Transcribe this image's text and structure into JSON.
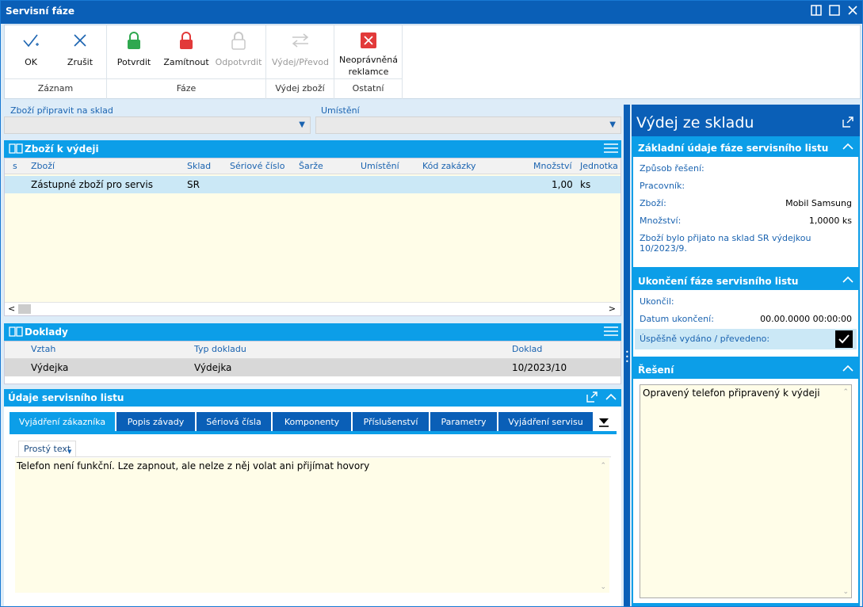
{
  "window": {
    "title": "Servisní fáze"
  },
  "ribbon": {
    "ok": "OK",
    "cancel": "Zrušit",
    "group_record": "Záznam",
    "confirm": "Potvrdit",
    "reject": "Zamítnout",
    "unconfirm": "Odpotvrdit",
    "group_phase": "Fáze",
    "issue": "Výdej/Převod",
    "group_issue": "Výdej zboží",
    "unjust_1": "Neoprávněná",
    "unjust_2": "reklamce",
    "group_other": "Ostatní"
  },
  "fields": {
    "prepare_label": "Zboží připravit na sklad",
    "location_label": "Umístění"
  },
  "goods_panel": {
    "title": "Zboží k výdeji",
    "columns": [
      "s",
      "Zboží",
      "Sklad",
      "Sériové číslo",
      "Šarže",
      "Umístění",
      "Kód zakázky",
      "Množství",
      "Jednotka"
    ],
    "rows": [
      {
        "goods": "Zástupné zboží pro servis",
        "warehouse": "SR",
        "qty": "1,00",
        "unit": "ks"
      }
    ]
  },
  "docs_panel": {
    "title": "Doklady",
    "columns": [
      "Vztah",
      "Typ dokladu",
      "Doklad"
    ],
    "rows": [
      {
        "relation": "Výdejka",
        "type": "Výdejka",
        "doc": "10/2023/10"
      }
    ]
  },
  "service_panel": {
    "title": "Údaje servisního listu",
    "tabs": [
      "Vyjádření zákazníka",
      "Popis závady",
      "Sériová čísla",
      "Komponenty",
      "Příslušenství",
      "Parametry",
      "Vyjádření servisu"
    ],
    "format": "Prostý text",
    "text": "Telefon není funkční. Lze zapnout, ale nelze z něj volat ani přijímat hovory"
  },
  "right": {
    "title": "Výdej ze skladu",
    "basic": {
      "title": "Základní údaje fáze servisního listu",
      "method_label": "Způsob řešení:",
      "worker_label": "Pracovník:",
      "goods_label": "Zboží:",
      "goods_value": "Mobil Samsung",
      "qty_label": "Množství:",
      "qty_value": "1,0000 ks",
      "note": "Zboží bylo přijato na sklad SR výdejkou 10/2023/9."
    },
    "end": {
      "title": "Ukončení fáze servisního listu",
      "ended_label": "Ukončil:",
      "date_label": "Datum ukončení:",
      "date_value": "00.00.0000 00:00:00",
      "success_label": "Úspěšně vydáno / převedeno:",
      "success_checked": true
    },
    "solution": {
      "title": "Řešení",
      "text": "Opravený telefon připravený k výdeji"
    }
  },
  "colors": {
    "title_bar": "#0a5fb7",
    "panel_header": "#0c9ee8",
    "grid_bg": "#fffde8"
  }
}
